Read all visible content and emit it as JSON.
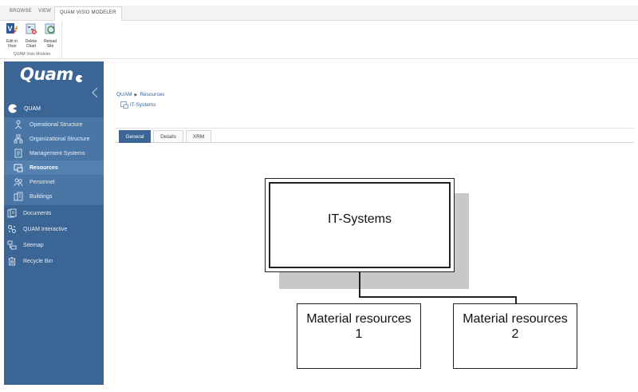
{
  "ribbon": {
    "tabs": [
      "BROWSE",
      "VIEW",
      "QUAM VISIO MODELER"
    ],
    "buttons": [
      {
        "label_line1": "Edit in",
        "label_line2": "Visio",
        "icon": "visio-icon"
      },
      {
        "label_line1": "Delete",
        "label_line2": "Chart",
        "icon": "delete-chart-icon"
      },
      {
        "label_line1": "Reload",
        "label_line2": "Site",
        "icon": "reload-site-icon"
      }
    ],
    "group_label": "QUAM Visio Modeler"
  },
  "nav": {
    "logo": "Quam",
    "root": "QUAM",
    "sub_items": [
      {
        "label": "Operational Structure",
        "icon": "operational-structure-icon"
      },
      {
        "label": "Organizational Structure",
        "icon": "organizational-structure-icon"
      },
      {
        "label": "Management Systems",
        "icon": "management-systems-icon"
      },
      {
        "label": "Resources",
        "icon": "resources-icon",
        "selected": true
      },
      {
        "label": "Personnel",
        "icon": "personnel-icon"
      },
      {
        "label": "Buildings",
        "icon": "buildings-icon"
      }
    ],
    "items": [
      {
        "label": "Documents",
        "icon": "documents-icon"
      },
      {
        "label": "QUAM Interactive",
        "icon": "quam-interactive-icon"
      },
      {
        "label": "Sitemap",
        "icon": "sitemap-icon"
      },
      {
        "label": "Recycle Bin",
        "icon": "recycle-bin-icon"
      }
    ]
  },
  "breadcrumb": {
    "root": "QUAM",
    "current": "Resources",
    "page": "IT-Systems"
  },
  "tabs": [
    "General",
    "Details",
    "XRM"
  ],
  "diagram": {
    "root": "IT-Systems",
    "children": [
      {
        "line1": "Material resources",
        "line2": "1"
      },
      {
        "line1": "Material resources",
        "line2": "2"
      }
    ]
  },
  "colors": {
    "nav_bg": "#3a6594",
    "nav_sub_bg": "#4a76a5",
    "accent": "#3a6594",
    "link": "#2f5f95"
  }
}
